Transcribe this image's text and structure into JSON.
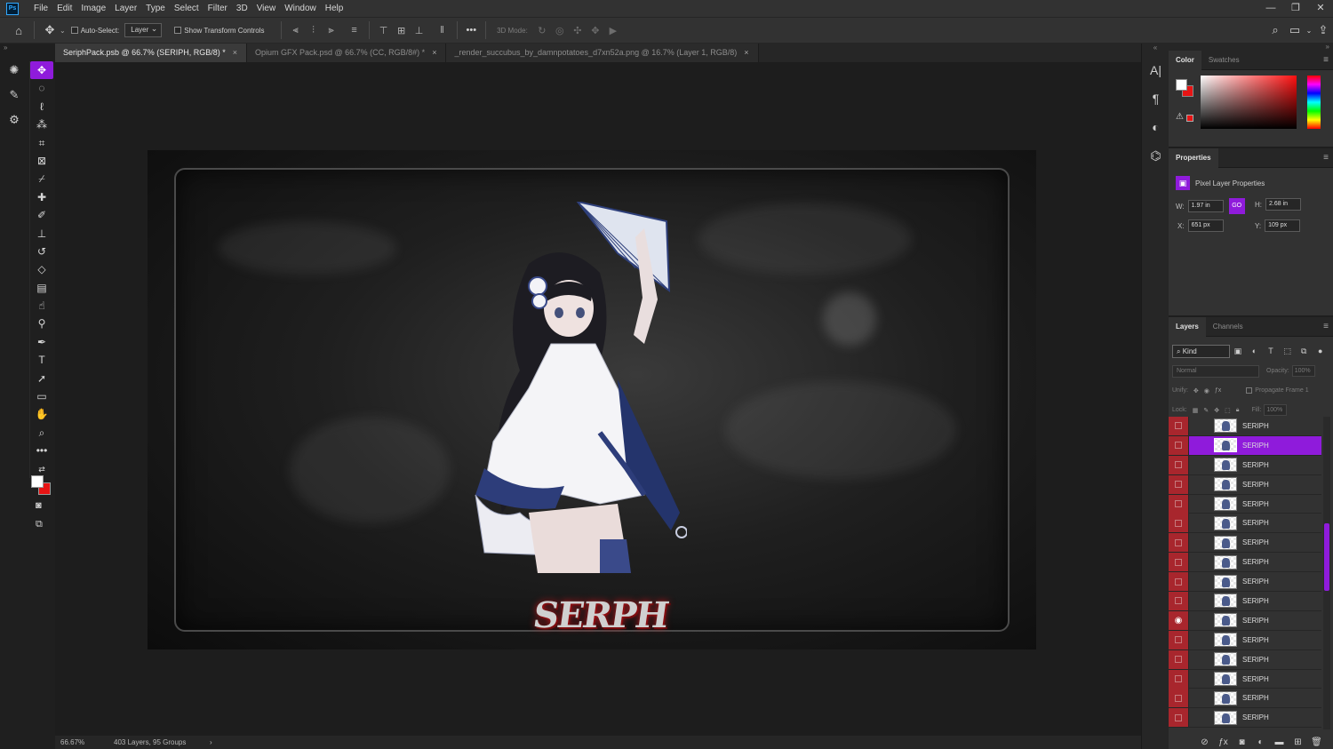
{
  "app": {
    "logo": "Ps"
  },
  "menu": [
    "File",
    "Edit",
    "Image",
    "Layer",
    "Type",
    "Select",
    "Filter",
    "3D",
    "View",
    "Window",
    "Help"
  ],
  "window_controls": [
    "—",
    "❐",
    "✕"
  ],
  "options": {
    "auto_select_label": "Auto-Select:",
    "auto_select_value": "Layer",
    "show_transform_label": "Show Transform Controls",
    "more": "•••",
    "mode_label": "3D Mode:"
  },
  "tabs": [
    {
      "label": "SeriphPack.psb @ 66.7% (SERIPH, RGB/8) *",
      "close": "×"
    },
    {
      "label": "Opium GFX Pack.psd @ 66.7% (CC, RGB/8#) *",
      "close": "×"
    },
    {
      "label": "_render_succubus_by_damnpotatoes_d7xn52a.png @ 16.7% (Layer 1, RGB/8)",
      "close": "×"
    }
  ],
  "canvas": {
    "logo_text": "SERPH"
  },
  "status": {
    "zoom": "66.67%",
    "doc_info": "403 Layers, 95 Groups",
    "arrow": "›"
  },
  "color_panel": {
    "tabs": [
      "Color",
      "Swatches"
    ],
    "menu": "≡",
    "fg": "#ffffff",
    "bg": "#e81414"
  },
  "properties": {
    "tab": "Properties",
    "menu": "≡",
    "title": "Pixel Layer Properties",
    "w_label": "W:",
    "w_value": "1.97 in",
    "link": "GO",
    "h_label": "H:",
    "h_value": "2.68 in",
    "x_label": "X:",
    "x_value": "651 px",
    "y_label": "Y:",
    "y_value": "109 px"
  },
  "layers": {
    "tabs": [
      "Layers",
      "Channels"
    ],
    "menu": "≡",
    "kind": "Kind",
    "blend_mode": "Normal",
    "opacity_label": "Opacity:",
    "opacity_value": "100%",
    "unify_label": "Unify:",
    "propagate_label": "Propagate Frame 1",
    "lock_label": "Lock:",
    "fill_label": "Fill:",
    "fill_value": "100%",
    "rows": [
      {
        "name": "SERIPH",
        "selected": false,
        "visible": false
      },
      {
        "name": "SERIPH",
        "selected": true,
        "visible": false
      },
      {
        "name": "SERIPH",
        "selected": false,
        "visible": false
      },
      {
        "name": "SERIPH",
        "selected": false,
        "visible": false
      },
      {
        "name": "SERIPH",
        "selected": false,
        "visible": false
      },
      {
        "name": "SERIPH",
        "selected": false,
        "visible": false
      },
      {
        "name": "SERIPH",
        "selected": false,
        "visible": false
      },
      {
        "name": "SERIPH",
        "selected": false,
        "visible": false
      },
      {
        "name": "SERIPH",
        "selected": false,
        "visible": false
      },
      {
        "name": "SERIPH",
        "selected": false,
        "visible": false
      },
      {
        "name": "SERIPH",
        "selected": false,
        "visible": true
      },
      {
        "name": "SERIPH",
        "selected": false,
        "visible": false
      },
      {
        "name": "SERIPH",
        "selected": false,
        "visible": false
      },
      {
        "name": "SERIPH",
        "selected": false,
        "visible": false
      },
      {
        "name": "SERIPH",
        "selected": false,
        "visible": false
      },
      {
        "name": "SERIPH",
        "selected": false,
        "visible": false
      }
    ]
  },
  "accent_color": "#8f1bdb",
  "layer_vis_color": "#a8262d"
}
